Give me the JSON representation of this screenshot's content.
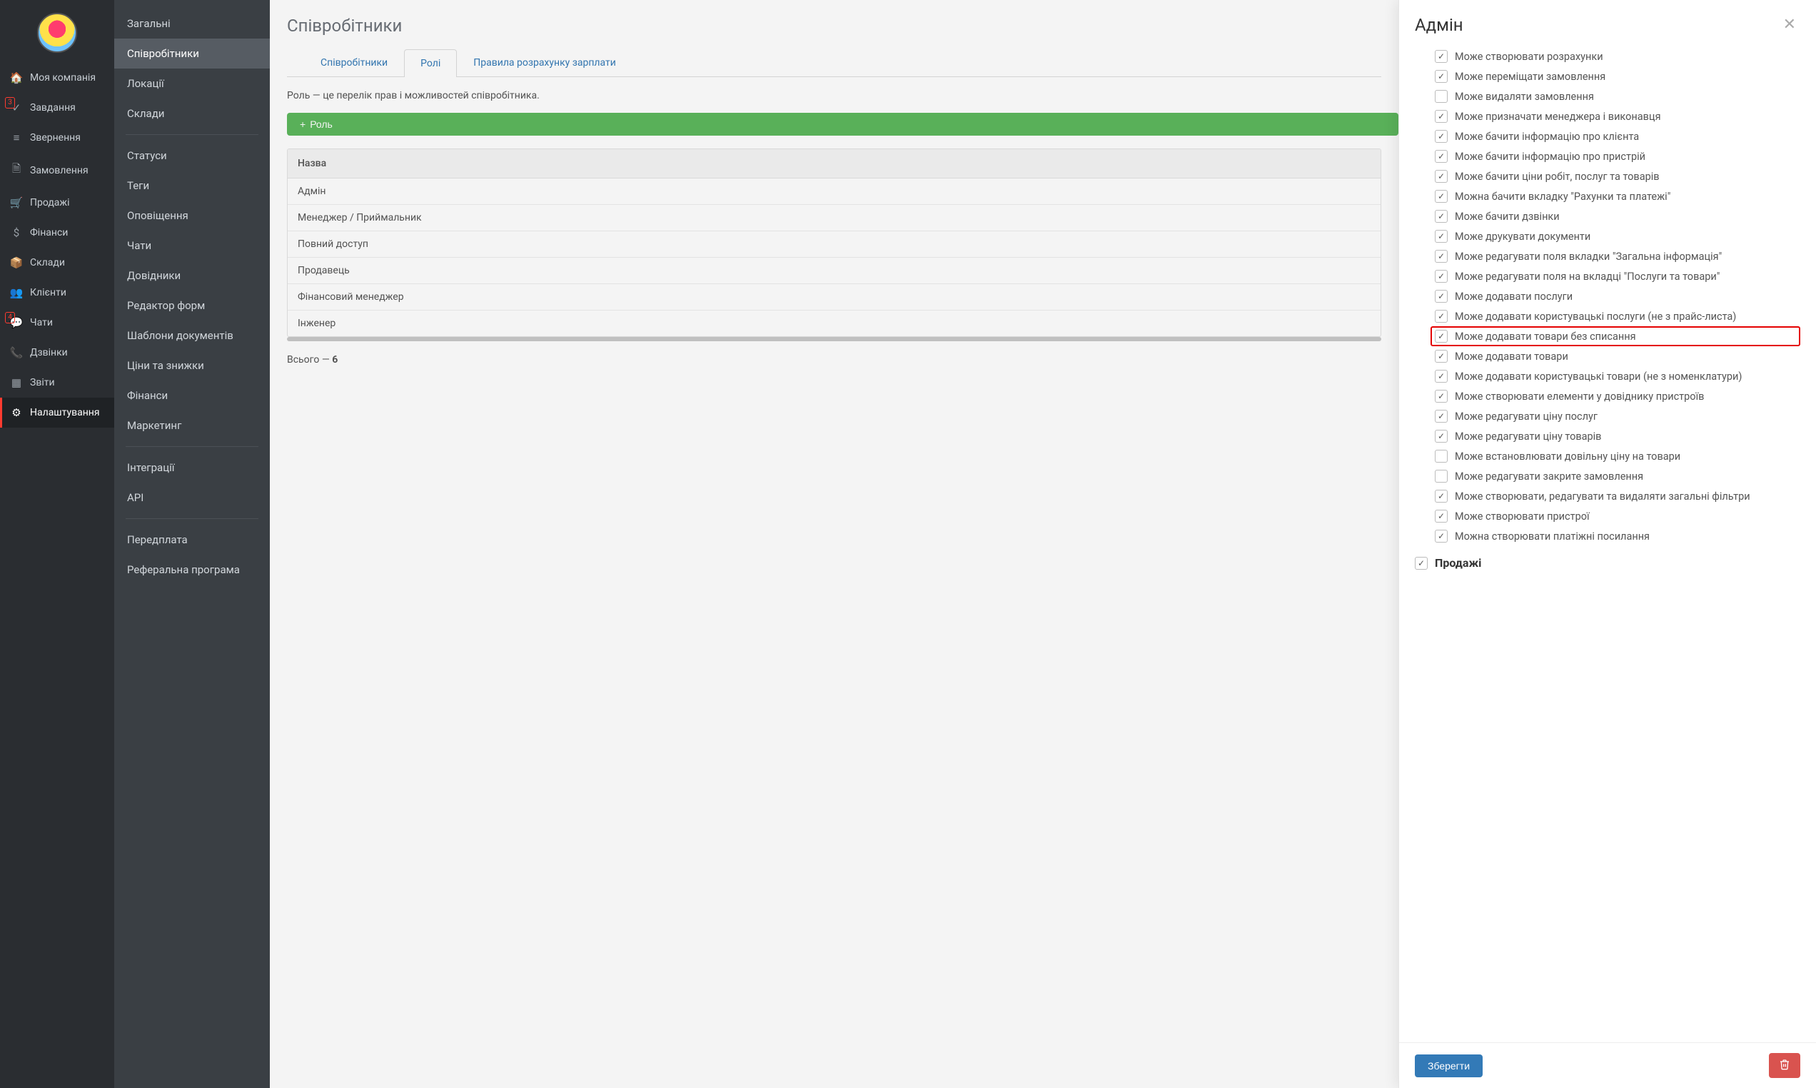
{
  "nav1": [
    {
      "icon": "🏠",
      "label": "Моя компанія",
      "badge": null,
      "active": false
    },
    {
      "icon": "✓",
      "label": "Завдання",
      "badge": "3",
      "badgeStyle": "outline",
      "active": false
    },
    {
      "icon": "≡",
      "label": "Звернення",
      "badge": null,
      "active": false
    },
    {
      "icon": "🗎",
      "label": "Замовлення",
      "badge": null,
      "active": false
    },
    {
      "icon": "🛒",
      "label": "Продажі",
      "badge": null,
      "active": false
    },
    {
      "icon": "$",
      "label": "Фінанси",
      "badge": null,
      "active": false
    },
    {
      "icon": "📦",
      "label": "Склади",
      "badge": null,
      "active": false
    },
    {
      "icon": "👥",
      "label": "Клієнти",
      "badge": null,
      "active": false
    },
    {
      "icon": "💬",
      "label": "Чати",
      "badge": "4",
      "badgeStyle": "outline",
      "active": false
    },
    {
      "icon": "📞",
      "label": "Дзвінки",
      "badge": null,
      "active": false
    },
    {
      "icon": "▦",
      "label": "Звіти",
      "badge": null,
      "active": false
    },
    {
      "icon": "⚙",
      "label": "Налаштування",
      "badge": null,
      "active": true
    }
  ],
  "nav2": [
    {
      "label": "Загальні",
      "active": false
    },
    {
      "label": "Співробітники",
      "active": true
    },
    {
      "label": "Локації",
      "active": false
    },
    {
      "label": "Склади",
      "active": false
    },
    {
      "sep": true
    },
    {
      "label": "Статуси",
      "active": false
    },
    {
      "label": "Теги",
      "active": false
    },
    {
      "label": "Оповіщення",
      "active": false
    },
    {
      "label": "Чати",
      "active": false
    },
    {
      "label": "Довідники",
      "active": false
    },
    {
      "label": "Редактор форм",
      "active": false
    },
    {
      "label": "Шаблони документів",
      "active": false
    },
    {
      "label": "Ціни та знижки",
      "active": false
    },
    {
      "label": "Фінанси",
      "active": false
    },
    {
      "label": "Маркетинг",
      "active": false
    },
    {
      "sep": true
    },
    {
      "label": "Інтеграції",
      "active": false
    },
    {
      "label": "API",
      "active": false
    },
    {
      "sep": true
    },
    {
      "label": "Передплата",
      "active": false
    },
    {
      "label": "Реферальна програма",
      "active": false
    }
  ],
  "page": {
    "title": "Співробітники",
    "tabs": [
      {
        "label": "Співробітники",
        "active": false
      },
      {
        "label": "Ролі",
        "active": true
      },
      {
        "label": "Правила розрахунку зарплати",
        "active": false
      }
    ],
    "role_desc": "Роль — це перелік прав і можливостей співробітника.",
    "add_btn": "Роль",
    "table_header": "Назва",
    "roles": [
      "Адмін",
      "Менеджер / Приймальник",
      "Повний доступ",
      "Продавець",
      "Фінансовий менеджер",
      "Інженер"
    ],
    "total_prefix": "Всього — ",
    "total_count": "6"
  },
  "panel": {
    "title": "Адмін",
    "permissions": [
      {
        "label": "Може створювати розрахунки",
        "checked": true
      },
      {
        "label": "Може переміщати замовлення",
        "checked": true
      },
      {
        "label": "Може видаляти замовлення",
        "checked": false
      },
      {
        "label": "Може призначати менеджера і виконавця",
        "checked": true
      },
      {
        "label": "Може бачити інформацію про клієнта",
        "checked": true
      },
      {
        "label": "Може бачити інформацію про пристрій",
        "checked": true
      },
      {
        "label": "Може бачити ціни робіт, послуг та товарів",
        "checked": true
      },
      {
        "label": "Можна бачити вкладку \"Рахунки та платежі\"",
        "checked": true
      },
      {
        "label": "Може бачити дзвінки",
        "checked": true
      },
      {
        "label": "Може друкувати документи",
        "checked": true
      },
      {
        "label": "Може редагувати поля вкладки \"Загальна інформація\"",
        "checked": true
      },
      {
        "label": "Може редагувати поля на вкладці \"Послуги та товари\"",
        "checked": true
      },
      {
        "label": "Може додавати послуги",
        "checked": true
      },
      {
        "label": "Може додавати користувацькі послуги (не з прайс-листа)",
        "checked": true
      },
      {
        "label": "Може додавати товари без списання",
        "checked": true,
        "highlight": true
      },
      {
        "label": "Може додавати товари",
        "checked": true
      },
      {
        "label": "Може додавати користувацькі товари (не з номенклатури)",
        "checked": true
      },
      {
        "label": "Може створювати елементи у довіднику пристроїв",
        "checked": true
      },
      {
        "label": "Може редагувати ціну послуг",
        "checked": true
      },
      {
        "label": "Може редагувати ціну товарів",
        "checked": true
      },
      {
        "label": "Може встановлювати довільну ціну на товари",
        "checked": false
      },
      {
        "label": "Може редагувати закрите замовлення",
        "checked": false
      },
      {
        "label": "Може створювати, редагувати та видаляти загальні фільтри",
        "checked": true
      },
      {
        "label": "Може створювати пристрої",
        "checked": true
      },
      {
        "label": "Можна створювати платіжні посилання",
        "checked": true
      }
    ],
    "section": {
      "label": "Продажі",
      "checked": true
    },
    "save": "Зберегти"
  }
}
